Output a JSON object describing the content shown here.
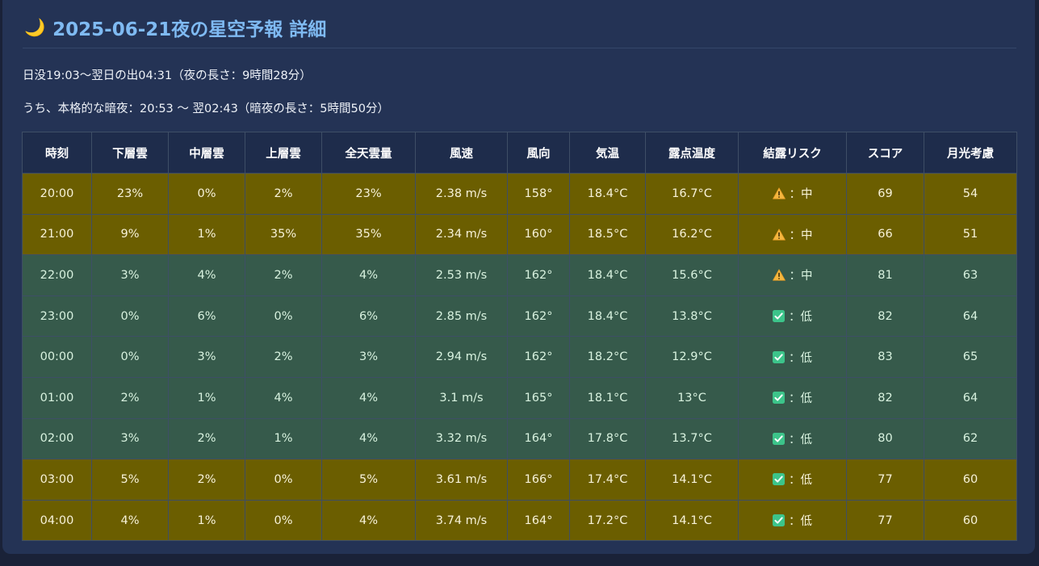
{
  "header": {
    "moon_icon": "🌙",
    "title": "2025-06-21夜の星空予報 詳細"
  },
  "info": {
    "night_span": "日没19:03〜翌日の出04:31（夜の長さ：9時間28分）",
    "dark_span": "うち、本格的な暗夜：20:53 〜 翌02:43（暗夜の長さ：5時間50分）"
  },
  "table": {
    "headers": [
      "時刻",
      "下層雲",
      "中層雲",
      "上層雲",
      "全天雲量",
      "風速",
      "風向",
      "気温",
      "露点温度",
      "結露リスク",
      "スコア",
      "月光考慮"
    ],
    "rows": [
      {
        "level": "mid",
        "risk_icon": "warning-icon",
        "cells": [
          "20:00",
          "23%",
          "0%",
          "2%",
          "23%",
          "2.38 m/s",
          "158°",
          "18.4°C",
          "16.7°C",
          "：中",
          "69",
          "54"
        ]
      },
      {
        "level": "mid",
        "risk_icon": "warning-icon",
        "cells": [
          "21:00",
          "9%",
          "1%",
          "35%",
          "35%",
          "2.34 m/s",
          "160°",
          "18.5°C",
          "16.2°C",
          "：中",
          "66",
          "51"
        ]
      },
      {
        "level": "good",
        "risk_icon": "warning-icon",
        "cells": [
          "22:00",
          "3%",
          "4%",
          "2%",
          "4%",
          "2.53 m/s",
          "162°",
          "18.4°C",
          "15.6°C",
          "：中",
          "81",
          "63"
        ]
      },
      {
        "level": "good",
        "risk_icon": "check-icon",
        "cells": [
          "23:00",
          "0%",
          "6%",
          "0%",
          "6%",
          "2.85 m/s",
          "162°",
          "18.4°C",
          "13.8°C",
          "：低",
          "82",
          "64"
        ]
      },
      {
        "level": "good",
        "risk_icon": "check-icon",
        "cells": [
          "00:00",
          "0%",
          "3%",
          "2%",
          "3%",
          "2.94 m/s",
          "162°",
          "18.2°C",
          "12.9°C",
          "：低",
          "83",
          "65"
        ]
      },
      {
        "level": "good",
        "risk_icon": "check-icon",
        "cells": [
          "01:00",
          "2%",
          "1%",
          "4%",
          "4%",
          "3.1 m/s",
          "165°",
          "18.1°C",
          "13°C",
          "：低",
          "82",
          "64"
        ]
      },
      {
        "level": "good",
        "risk_icon": "check-icon",
        "cells": [
          "02:00",
          "3%",
          "2%",
          "1%",
          "4%",
          "3.32 m/s",
          "164°",
          "17.8°C",
          "13.7°C",
          "：低",
          "80",
          "62"
        ]
      },
      {
        "level": "mid",
        "risk_icon": "check-icon",
        "cells": [
          "03:00",
          "5%",
          "2%",
          "0%",
          "5%",
          "3.61 m/s",
          "166°",
          "17.4°C",
          "14.1°C",
          "：低",
          "77",
          "60"
        ]
      },
      {
        "level": "mid",
        "risk_icon": "check-icon",
        "cells": [
          "04:00",
          "4%",
          "1%",
          "0%",
          "4%",
          "3.74 m/s",
          "164°",
          "17.2°C",
          "14.1°C",
          "：低",
          "77",
          "60"
        ]
      }
    ]
  },
  "colors": {
    "page_bg": "#1a2238",
    "panel_bg": "#243355",
    "title": "#7fbaf2",
    "header_bg": "#1e2c4b",
    "row_mid_bg": "#6b5e00",
    "row_good_bg": "#365a4b",
    "warning": "#f4b63f",
    "check": "#3cc48a"
  }
}
